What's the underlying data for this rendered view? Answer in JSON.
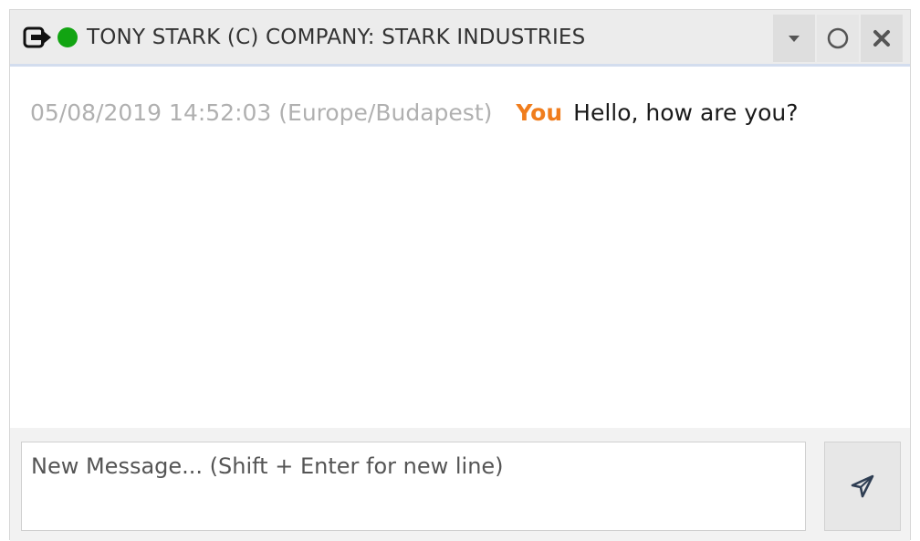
{
  "chat": {
    "title": "TONY STARK (C) COMPANY: STARK INDUSTRIES",
    "status_color": "#12a412",
    "status": "online",
    "icons": {
      "leave": "arrow-right-from-bracket-icon",
      "minimize": "chevron-down-icon",
      "restore": "circle-icon",
      "close": "close-icon",
      "send": "paper-plane-icon"
    }
  },
  "messages": [
    {
      "timestamp": "05/08/2019 14:52:03 (Europe/Budapest)",
      "author": "You",
      "text": "Hello, how are you?"
    }
  ],
  "composer": {
    "placeholder": "New Message... (Shift + Enter for new line)"
  },
  "colors": {
    "accent": "#f07d1d",
    "status_online": "#12a412"
  }
}
